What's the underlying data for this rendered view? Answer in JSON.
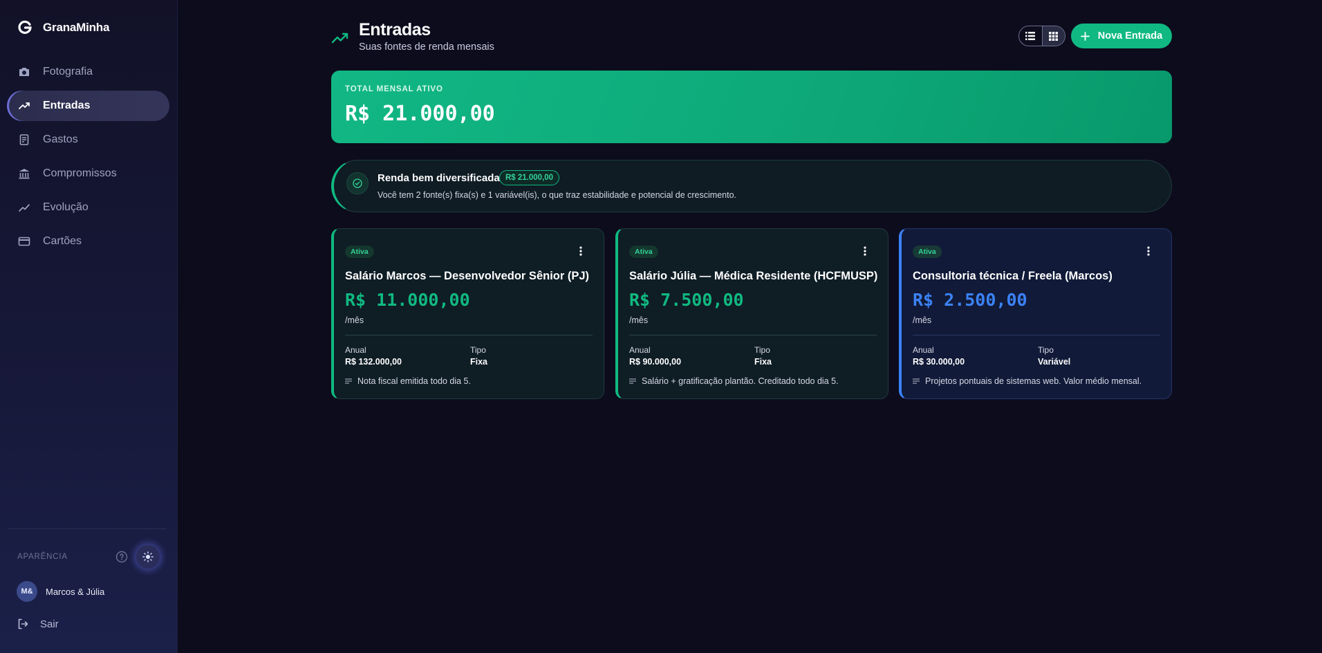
{
  "app": {
    "name": "GranaMinha"
  },
  "sidebar": {
    "items": [
      {
        "label": "Fotografia",
        "icon": "camera-icon"
      },
      {
        "label": "Entradas",
        "icon": "trending-up-icon",
        "active": true
      },
      {
        "label": "Gastos",
        "icon": "receipt-icon"
      },
      {
        "label": "Compromissos",
        "icon": "bank-icon"
      },
      {
        "label": "Evolução",
        "icon": "line-chart-icon"
      },
      {
        "label": "Cartões",
        "icon": "credit-card-icon"
      }
    ],
    "appearance_label": "APARÊNCIA",
    "user": {
      "initials": "M&",
      "name": "Marcos & Júlia"
    },
    "logout_label": "Sair"
  },
  "header": {
    "title": "Entradas",
    "subtitle": "Suas fontes de renda mensais",
    "new_button_label": "Nova Entrada"
  },
  "total": {
    "label": "TOTAL MENSAL ATIVO",
    "value": "R$ 21.000,00"
  },
  "insight": {
    "title": "Renda bem diversificada",
    "badge": "R$ 21.000,00",
    "text": "Você tem 2 fonte(s) fixa(s) e 1 variável(is), o que traz estabilidade e potencial de crescimento."
  },
  "cards": [
    {
      "status": "Ativa",
      "title": "Salário Marcos — Desenvolvedor Sênior (PJ)",
      "amount": "R$ 11.000,00",
      "period": "/mês",
      "annual_label": "Anual",
      "annual_value": "R$ 132.000,00",
      "type_label": "Tipo",
      "type_value": "Fixa",
      "note": "Nota fiscal emitida todo dia 5."
    },
    {
      "status": "Ativa",
      "title": "Salário Júlia — Médica Residente (HCFMUSP)",
      "amount": "R$ 7.500,00",
      "period": "/mês",
      "annual_label": "Anual",
      "annual_value": "R$ 90.000,00",
      "type_label": "Tipo",
      "type_value": "Fixa",
      "note": "Salário + gratificação plantão. Creditado todo dia 5."
    },
    {
      "status": "Ativa",
      "title": "Consultoria técnica / Freela (Marcos)",
      "amount": "R$ 2.500,00",
      "period": "/mês",
      "annual_label": "Anual",
      "annual_value": "R$ 30.000,00",
      "type_label": "Tipo",
      "type_value": "Variável",
      "note": "Projetos pontuais de sistemas web. Valor médio mensal."
    }
  ],
  "colors": {
    "accent_green": "#10b981",
    "accent_blue": "#3b82f6",
    "background": "#0d0c1d"
  }
}
